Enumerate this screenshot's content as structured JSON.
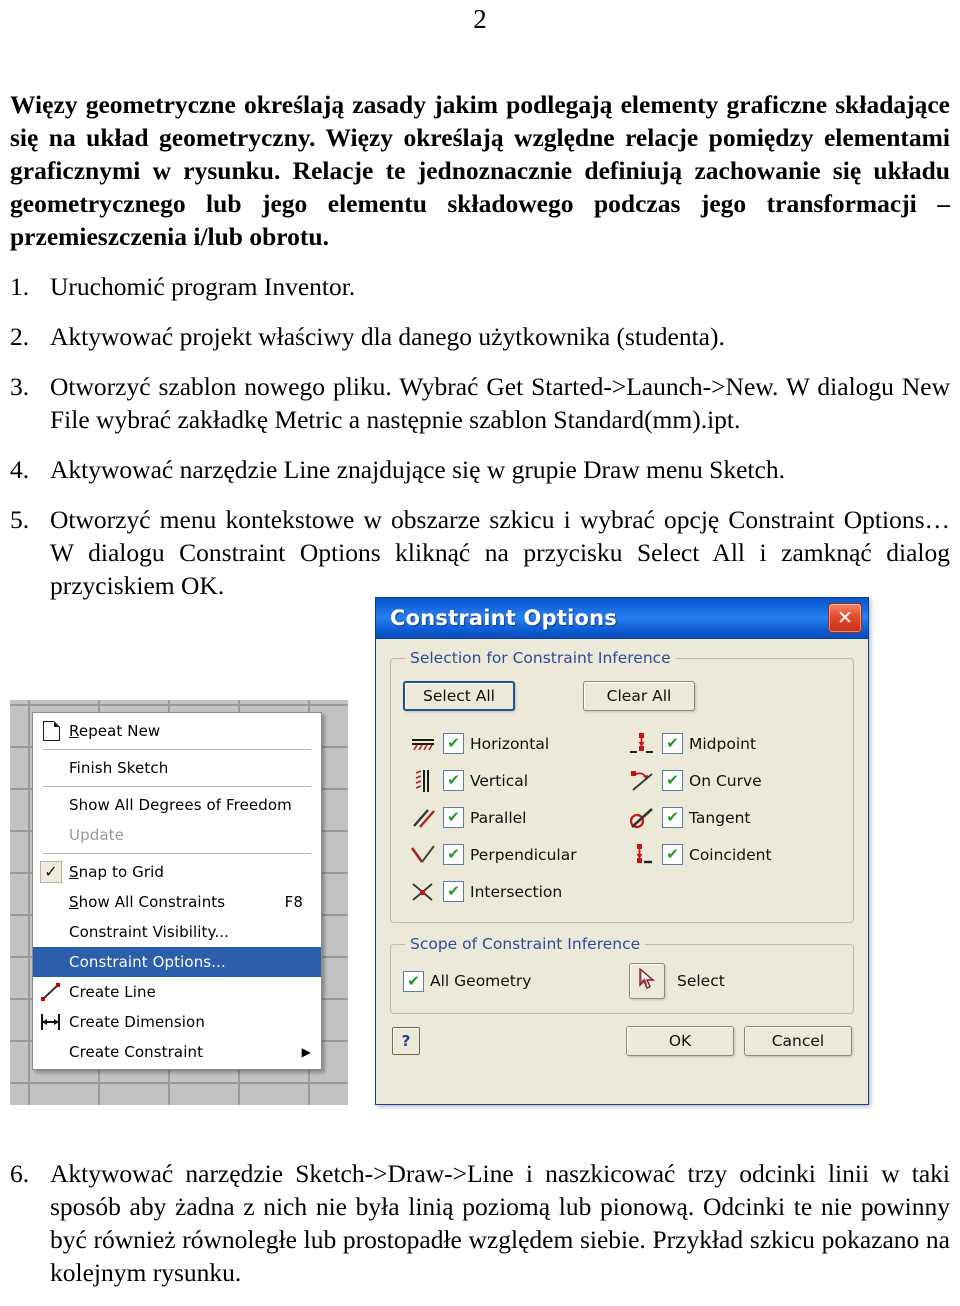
{
  "document": {
    "page_number": "2",
    "intro_paragraph": "Więzy geometryczne określają zasady jakim podlegają elementy graficzne składające się na układ geometryczny. Więzy określają względne relacje pomiędzy elementami graficznymi w rysunku. Relacje te jednoznacznie definiują zachowanie się układu geometrycznego lub jego elementu składowego podczas jego transformacji – przemieszczenia i/lub obrotu.",
    "steps": [
      {
        "num": "1.",
        "text": "Uruchomić program Inventor."
      },
      {
        "num": "2.",
        "text": "Aktywować projekt właściwy dla danego użytkownika (studenta)."
      },
      {
        "num": "3.",
        "text": "Otworzyć szablon nowego pliku. Wybrać Get Started->Launch->New. W dialogu New File wybrać zakładkę Metric a następnie szablon Standard(mm).ipt."
      },
      {
        "num": "4.",
        "text": "Aktywować narzędzie Line znajdujące się w grupie Draw menu Sketch."
      },
      {
        "num": "5.",
        "text": "Otworzyć menu kontekstowe w obszarze szkicu i wybrać opcję Constraint Options… W dialogu Constraint Options kliknąć na przycisku Select All i zamknąć dialog przyciskiem OK."
      }
    ],
    "tail_step": {
      "num": "6.",
      "text": "Aktywować narzędzie Sketch->Draw->Line i naszkicować trzy odcinki linii w taki sposób aby żadna z nich nie była linią poziomą lub pionową. Odcinki te nie powinny być również równoległe lub prostopadłe względem siebie. Przykład szkicu pokazano na kolejnym rysunku."
    }
  },
  "context_menu": {
    "items": [
      {
        "label": "Repeat New",
        "mnemonic": "R",
        "icon": "page-icon",
        "state": "normal"
      },
      {
        "separator": true
      },
      {
        "label": "Finish Sketch",
        "icon": "",
        "state": "normal"
      },
      {
        "separator": true
      },
      {
        "label": "Show All Degrees of Freedom",
        "icon": "",
        "state": "normal"
      },
      {
        "label": "Update",
        "icon": "",
        "state": "disabled"
      },
      {
        "separator": true
      },
      {
        "label": "Snap to Grid",
        "mnemonic": "S",
        "icon": "checkmark-icon",
        "state": "checked"
      },
      {
        "label": "Show All Constraints",
        "mnemonic": "S",
        "accel": "F8",
        "icon": "",
        "state": "normal"
      },
      {
        "label": "Constraint Visibility...",
        "icon": "",
        "state": "normal"
      },
      {
        "label": "Constraint Options...",
        "icon": "",
        "state": "selected"
      },
      {
        "label": "Create Line",
        "icon": "line-icon",
        "state": "normal"
      },
      {
        "label": "Create Dimension",
        "icon": "dimension-icon",
        "state": "normal"
      },
      {
        "label": "Create Constraint",
        "icon": "",
        "state": "normal",
        "submenu": true
      }
    ]
  },
  "dialog": {
    "title": "Constraint Options",
    "close_label": "✕",
    "selection_group": {
      "legend": "Selection for Constraint Inference",
      "select_all_label": "Select All",
      "clear_all_label": "Clear All",
      "left_column": [
        {
          "label": "Horizontal",
          "icon": "horizontal-constraint-icon",
          "checked": true
        },
        {
          "label": "Vertical",
          "icon": "vertical-constraint-icon",
          "checked": true
        },
        {
          "label": "Parallel",
          "icon": "parallel-constraint-icon",
          "checked": true
        },
        {
          "label": "Perpendicular",
          "icon": "perpendicular-constraint-icon",
          "checked": true
        },
        {
          "label": "Intersection",
          "icon": "intersection-constraint-icon",
          "checked": true
        }
      ],
      "right_column": [
        {
          "label": "Midpoint",
          "icon": "midpoint-constraint-icon",
          "checked": true
        },
        {
          "label": "On Curve",
          "icon": "on-curve-constraint-icon",
          "checked": true
        },
        {
          "label": "Tangent",
          "icon": "tangent-constraint-icon",
          "checked": true
        },
        {
          "label": "Coincident",
          "icon": "coincident-constraint-icon",
          "checked": true
        }
      ]
    },
    "scope_group": {
      "legend": "Scope of Constraint Inference",
      "all_geometry_label": "All Geometry",
      "all_geometry_checked": true,
      "select_label": "Select",
      "select_icon": "cursor-arrow-icon"
    },
    "footer": {
      "help_label": "?",
      "ok_label": "OK",
      "cancel_label": "Cancel"
    },
    "colors": {
      "titlebar_blue": "#1064da",
      "face": "#ece9d8",
      "legend_text": "#2b4a9b",
      "close_red": "#e24c2a",
      "check_green": "#1f9c28",
      "menu_highlight": "#2b5fad"
    }
  }
}
